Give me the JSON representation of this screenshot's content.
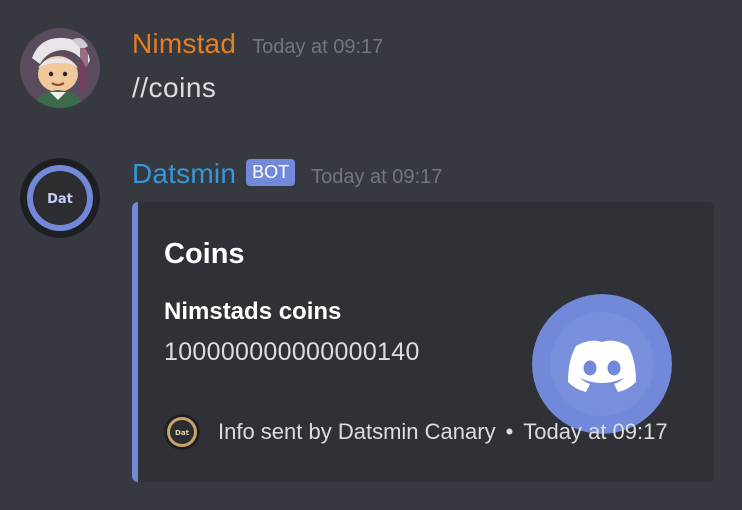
{
  "messages": [
    {
      "username": "Nimstad",
      "username_color": "#e67e22",
      "timestamp": "Today at 09:17",
      "content": "//coins",
      "avatar_icon": "user-avatar"
    },
    {
      "username": "Datsmin",
      "username_color": "#3498db",
      "bot_tag": "BOT",
      "timestamp": "Today at 09:17",
      "avatar_icon": "bot-avatar",
      "avatar_text": "Dat",
      "embed": {
        "accent_color": "#7289da",
        "title": "Coins",
        "field_name": "Nimstads coins",
        "field_value": "100000000000000140",
        "thumbnail_icon": "discord-logo-icon",
        "footer_icon": "bot-avatar-small",
        "footer_icon_text": "Dat",
        "footer_text": "Info sent by Datsmin Canary",
        "footer_separator": "•",
        "footer_timestamp": "Today at 09:17"
      }
    }
  ],
  "colors": {
    "background": "#36393f",
    "embed_background": "#2f3136",
    "text": "#dcddde",
    "muted": "#72767d",
    "blurple": "#7289da"
  }
}
